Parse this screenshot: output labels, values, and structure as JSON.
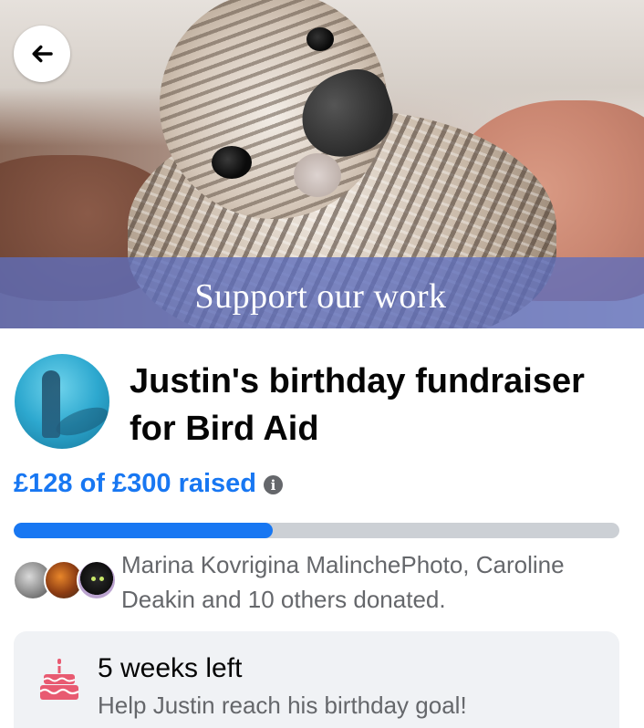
{
  "cover": {
    "banner_text": "Support our work"
  },
  "nav": {
    "back_icon": "arrow-left-icon"
  },
  "fundraiser": {
    "title": "Justin's birthday fundraiser for Bird Aid",
    "raised_text": "£128 of £300 raised",
    "raised_amount": 128,
    "goal_amount": 300,
    "progress_fraction": 0.427
  },
  "donors": {
    "text": "Marina Kovrigina MalinchePhoto, Caroline Deakin and 10 others donated."
  },
  "birthday_card": {
    "icon": "birthday-cake-icon",
    "title": "5 weeks left",
    "subtitle": "Help Justin reach his birthday goal!"
  },
  "colors": {
    "accent": "#1877f2",
    "progress_track": "#ccd0d5",
    "secondary_text": "#65676b",
    "card_bg": "#f0f2f5",
    "cake": "#e85a71"
  }
}
